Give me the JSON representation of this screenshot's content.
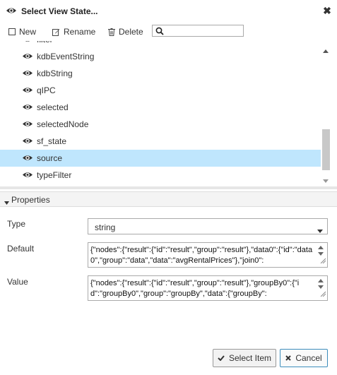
{
  "dialog": {
    "title": "Select View State..."
  },
  "toolbar": {
    "new_label": "New",
    "rename_label": "Rename",
    "delete_label": "Delete"
  },
  "search": {
    "value": "",
    "placeholder": ""
  },
  "list": {
    "partial_item": "filter",
    "items": [
      {
        "label": "kdbEventString"
      },
      {
        "label": "kdbString"
      },
      {
        "label": "qIPC"
      },
      {
        "label": "selected"
      },
      {
        "label": "selectedNode"
      },
      {
        "label": "sf_state"
      },
      {
        "label": "source",
        "selected": true
      },
      {
        "label": "typeFilter"
      }
    ]
  },
  "properties": {
    "header": "Properties",
    "type_label": "Type",
    "type_value": "string",
    "default_label": "Default",
    "default_value": "{\"nodes\":{\"result\":{\"id\":\"result\",\"group\":\"result\"},\"data0\":{\"id\":\"data0\",\"group\":\"data\",\"data\":\"avgRentalPrices\"},\"join0\":",
    "value_label": "Value",
    "value_value": "{\"nodes\":{\"result\":{\"id\":\"result\",\"group\":\"result\"},\"groupBy0\":{\"id\":\"groupBy0\",\"group\":\"groupBy\",\"data\":{\"groupBy\":"
  },
  "footer": {
    "select_label": "Select Item",
    "cancel_label": "Cancel"
  },
  "colors": {
    "selection": "#bfe6fd",
    "accent": "#3c8dbc"
  }
}
